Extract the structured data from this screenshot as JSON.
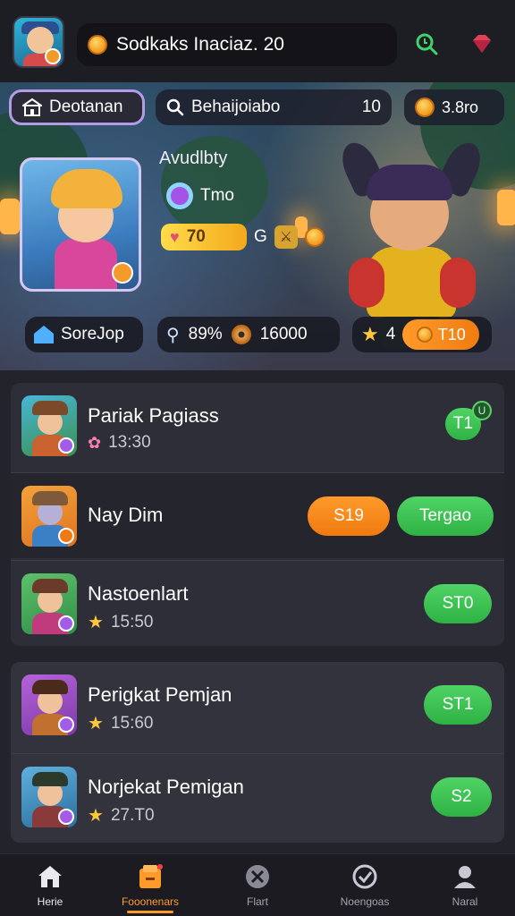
{
  "header": {
    "title": "Sodkaks Inaciaz. 20",
    "icons": [
      "avatar",
      "coin-icon",
      "search-icon",
      "gem-icon"
    ]
  },
  "hero": {
    "download_label": "Deotanan",
    "search_label": "Behaijoiabo",
    "search_value": "10",
    "coins_value": "3.8ro",
    "availability_label": "Avudlbty",
    "timer_label": "Tmo",
    "health_value": "70",
    "hp_suffix": "G",
    "shop_label": "SoreJop",
    "stat_percent": "89%",
    "stat_coins": "16000",
    "level_value": "4",
    "level_button": "T10"
  },
  "list": [
    {
      "title": "Pariak Pagiass",
      "meta": "13:30",
      "action": "T1",
      "badge": "U",
      "meta_icon": "bow-icon"
    },
    {
      "title": "Nay Dim",
      "meta": "",
      "action_secondary": "S19",
      "action": "Tergao"
    },
    {
      "title": "Nastoenlart",
      "meta": "15:50",
      "action": "ST0",
      "meta_icon": "star-icon"
    },
    {
      "title": "Perigkat Pemjan",
      "meta": "15:60",
      "action": "ST1",
      "meta_icon": "star-icon"
    },
    {
      "title": "Norjekat Pemigan",
      "meta": "27.T0",
      "action": "S2",
      "meta_icon": "star-icon"
    }
  ],
  "nav": [
    {
      "label": "Herie",
      "icon": "home-icon"
    },
    {
      "label": "Fooonenars",
      "icon": "folder-icon",
      "active": true
    },
    {
      "label": "Flart",
      "icon": "tools-icon"
    },
    {
      "label": "Noengoas",
      "icon": "check-circle-icon"
    },
    {
      "label": "Naral",
      "icon": "profile-icon"
    }
  ],
  "colors": {
    "accent_orange": "#ff9a2a",
    "accent_green": "#3cc451",
    "background": "#23232b"
  }
}
